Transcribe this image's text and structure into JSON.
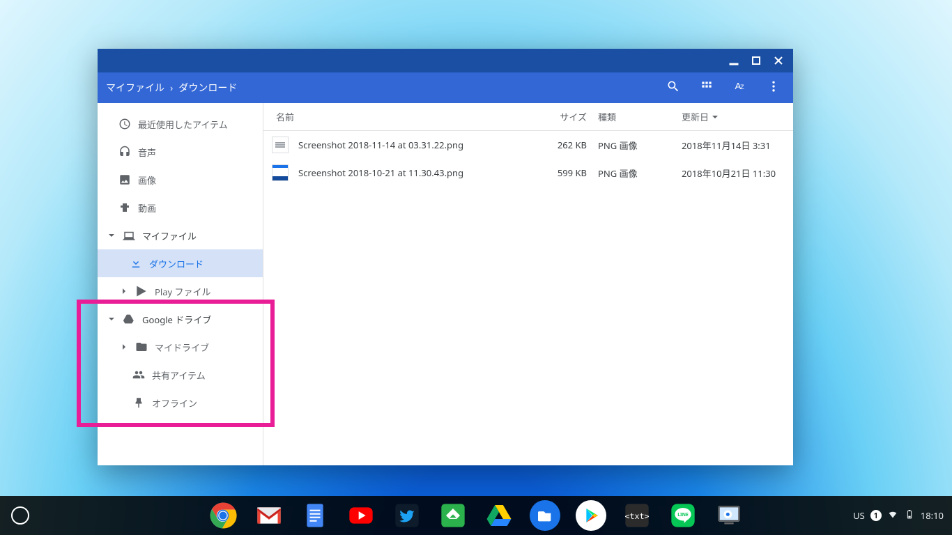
{
  "window": {
    "breadcrumb": [
      "マイファイル",
      "ダウンロード"
    ]
  },
  "sidebar": {
    "recent": "最近使用したアイテム",
    "audio": "音声",
    "images": "画像",
    "videos": "動画",
    "myfiles": "マイファイル",
    "downloads": "ダウンロード",
    "playfiles": "Play ファイル",
    "gdrive": "Google ドライブ",
    "mydrive": "マイドライブ",
    "shared": "共有アイテム",
    "offline": "オフライン"
  },
  "columns": {
    "name": "名前",
    "size": "サイズ",
    "type": "種類",
    "date": "更新日"
  },
  "files": [
    {
      "name": "Screenshot 2018-11-14 at 03.31.22.png",
      "size": "262 KB",
      "type": "PNG 画像",
      "date": "2018年11月14日 3:31"
    },
    {
      "name": "Screenshot 2018-10-21 at 11.30.43.png",
      "size": "599 KB",
      "type": "PNG 画像",
      "date": "2018年10月21日 11:30"
    }
  ],
  "status": {
    "ime": "US",
    "notif": "1",
    "time": "18:10"
  }
}
